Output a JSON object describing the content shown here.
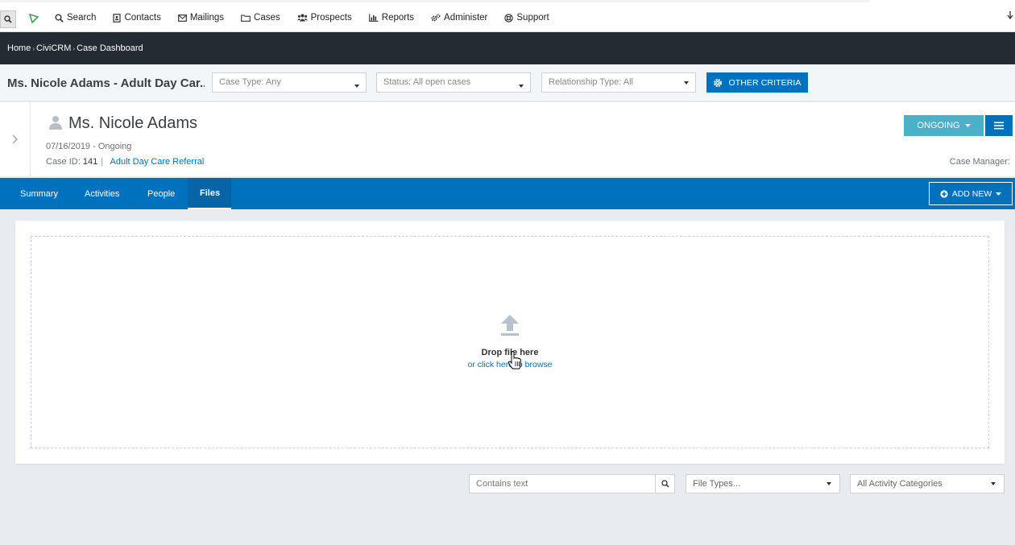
{
  "topbar": {
    "menu": [
      {
        "label": "Search",
        "icon": "search-icon"
      },
      {
        "label": "Contacts",
        "icon": "address-book-icon"
      },
      {
        "label": "Mailings",
        "icon": "envelope-icon"
      },
      {
        "label": "Cases",
        "icon": "folder-icon"
      },
      {
        "label": "Prospects",
        "icon": "users-icon"
      },
      {
        "label": "Reports",
        "icon": "bar-chart-icon"
      },
      {
        "label": "Administer",
        "icon": "gears-icon"
      },
      {
        "label": "Support",
        "icon": "life-ring-icon"
      }
    ]
  },
  "breadcrumb": {
    "items": [
      "Home",
      "CiviCRM",
      "Case Dashboard"
    ],
    "separator": "›"
  },
  "filters": {
    "case_title": "Ms. Nicole Adams - Adult Day Car...",
    "case_type": "Case Type: Any",
    "status": "Status: All open cases",
    "relationship_type": "Relationship Type: All",
    "other_criteria": "OTHER CRITERIA"
  },
  "case": {
    "client_name": "Ms. Nicole Adams",
    "date_status": "07/16/2019 - Ongoing",
    "case_id_label": "Case ID:",
    "case_id": "141",
    "case_type_link": "Adult Day Care Referral",
    "status_button": "ONGOING",
    "case_manager_label": "Case Manager:"
  },
  "tabs": [
    {
      "label": "Summary",
      "active": false
    },
    {
      "label": "Activities",
      "active": false
    },
    {
      "label": "People",
      "active": false
    },
    {
      "label": "Files",
      "active": true
    }
  ],
  "add_new": "ADD NEW",
  "dropzone": {
    "title": "Drop file here",
    "subtitle": "or click here to browse"
  },
  "file_filters": {
    "contains_placeholder": "Contains text",
    "file_types": "File Types...",
    "activity_categories": "All Activity Categories"
  },
  "colors": {
    "primary": "#0071bd",
    "status_button": "#4bb0c8",
    "nav_dark": "#252b32"
  }
}
